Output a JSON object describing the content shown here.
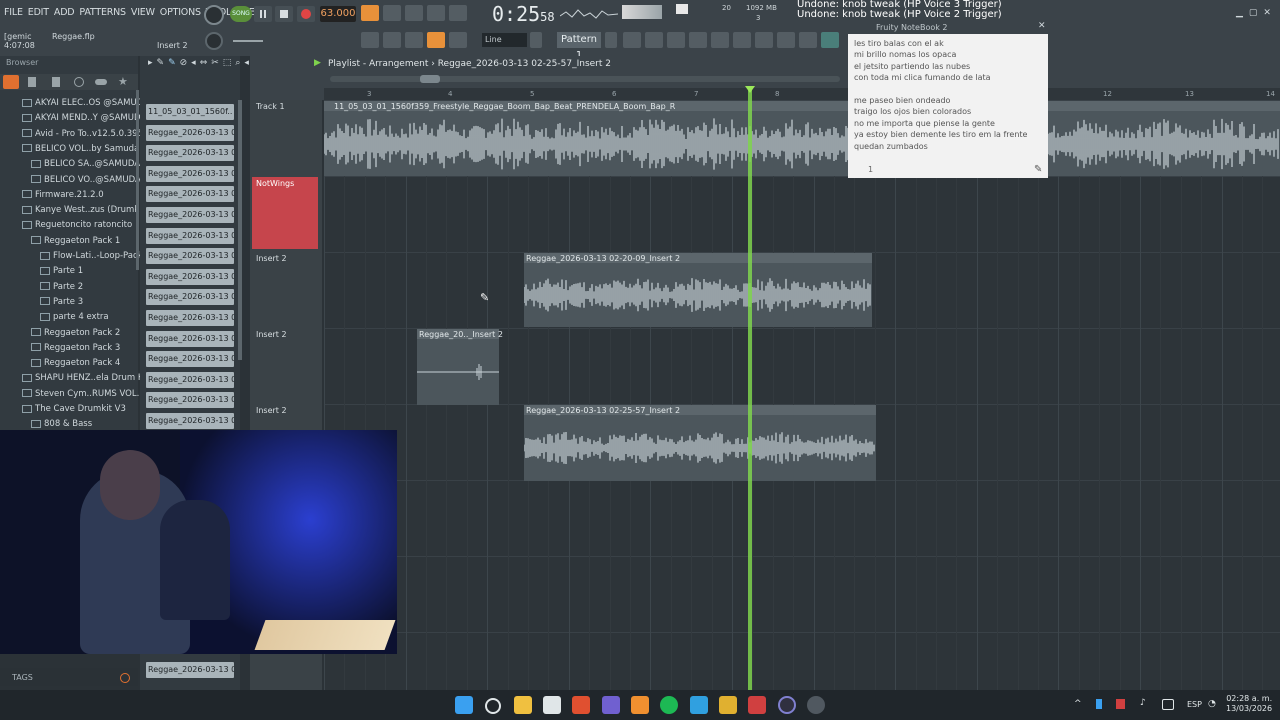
{
  "menu": [
    "FILE",
    "EDIT",
    "ADD",
    "PATTERNS",
    "VIEW",
    "OPTIONS",
    "TOOLS",
    "HELP"
  ],
  "transport": {
    "mode": "SONG",
    "tempo": "63.000",
    "time_main": "0:25",
    "time_sub": "58",
    "cpu": "20",
    "mem": "1092 MB",
    "voices": "3"
  },
  "undo_msg": [
    "Undone: knob tweak (HP Voice 3 Trigger)",
    "Undone: knob tweak (HP Voice 2 Trigger)"
  ],
  "project": {
    "file": "Reggae.flp",
    "position": "4:07:08",
    "insert": "Insert 2",
    "input": "[gemic"
  },
  "toolbar": {
    "snap": "Line",
    "pattern": "Pattern 1"
  },
  "browser": {
    "title": "Browser",
    "items": [
      {
        "label": "AKYAI ELEC..OS @SAMUDAI",
        "indent": 0
      },
      {
        "label": "AKYAI MEND..Y @SAMUDAI",
        "indent": 0
      },
      {
        "label": "Avid - Pro To..v12.5.0.395",
        "indent": 0
      },
      {
        "label": "BELICO VOL..by Samudai",
        "indent": 0
      },
      {
        "label": "BELICO SA..@SAMUDAI",
        "indent": 1
      },
      {
        "label": "BELICO VO..@SAMUDAI",
        "indent": 1
      },
      {
        "label": "Firmware.21.2.0",
        "indent": 0
      },
      {
        "label": "Kanye West..zus (Drumkit)",
        "indent": 0
      },
      {
        "label": "Reguetoncito ratoncito",
        "indent": 0
      },
      {
        "label": "Reggaeton Pack 1",
        "indent": 1
      },
      {
        "label": "Flow-Lati..-Loop-Pack",
        "indent": 2
      },
      {
        "label": "Parte 1",
        "indent": 2
      },
      {
        "label": "Parte 2",
        "indent": 2
      },
      {
        "label": "Parte 3",
        "indent": 2
      },
      {
        "label": "parte 4 extra",
        "indent": 2
      },
      {
        "label": "Reggaeton Pack 2",
        "indent": 1
      },
      {
        "label": "Reggaeton Pack 3",
        "indent": 1
      },
      {
        "label": "Reggaeton Pack 4",
        "indent": 1
      },
      {
        "label": "SHAPU HENZ..ela Drum Kit",
        "indent": 0
      },
      {
        "label": "Steven Cym..RUMS VOL. 1",
        "indent": 0
      },
      {
        "label": "The Cave Drumkit V3",
        "indent": 0
      },
      {
        "label": "808 & Bass",
        "indent": 1
      }
    ],
    "tags_label": "TAGS"
  },
  "channels": [
    "11_05_03_01_1560f..",
    "Reggae_2026-03-13 01-..",
    "Reggae_2026-03-13 01-..",
    "Reggae_2026-03-13 01-..",
    "Reggae_2026-03-13 01-..",
    "Reggae_2026-03-13 01-..",
    "Reggae_2026-03-13 01-..",
    "Reggae_2026-03-13 01-..",
    "Reggae_2026-03-13 01-..",
    "Reggae_2026-03-13 01-..",
    "Reggae_2026-03-13 01-..",
    "Reggae_2026-03-13 01-..",
    "Reggae_2026-03-13 01-..",
    "Reggae_2026-03-13 01-..",
    "Reggae_2026-03-13 01-..",
    "Reggae_2026-03-13 01-..",
    "Reggae_2026-03-13 02-.."
  ],
  "playlist": {
    "title": "Playlist - Arrangement",
    "crumb": "Reggae_2026-03-13 02-25-57_Insert 2",
    "ruler": [
      "3",
      "4",
      "5",
      "6",
      "7",
      "8",
      "9",
      "10",
      "11",
      "12",
      "13",
      "14"
    ],
    "tracks": [
      {
        "label": "Track 1"
      },
      {
        "label": "NotWings"
      },
      {
        "label": "Insert 2"
      },
      {
        "label": "Insert 2"
      },
      {
        "label": "Insert 2"
      }
    ],
    "clips": {
      "c1": "11_05_03_01_1560f359_Freestyle_Reggae_Boom_Bap_Beat_PRENDELA_Boom_Bap_R",
      "c2": "Reggae_2026-03-13 02-20-09_Insert 2",
      "c3": "Reggae_20.._Insert 2",
      "c4": "Reggae_2026-03-13 02-25-57_Insert 2"
    }
  },
  "notebook": {
    "title": "Fruity NoteBook 2",
    "lines": [
      "les tiro balas con el ak",
      "mi brillo nomas los opaca",
      "el jetsito partiendo las nubes",
      "con toda mi clica fumando de lata",
      "",
      "me paseo bien ondeado",
      "traigo los ojos bien colorados",
      "no me importa que piense la gente",
      "ya estoy bien demente les tiro em la frente",
      "quedan zumbados"
    ],
    "page": "1"
  },
  "taskbar": {
    "lang": "ESP",
    "time": "02:28 a. m.",
    "date": "13/03/2026"
  },
  "colors": {
    "playhead": "#7fd34d",
    "notwings": "#c6454c",
    "accent": "#f0a060"
  }
}
